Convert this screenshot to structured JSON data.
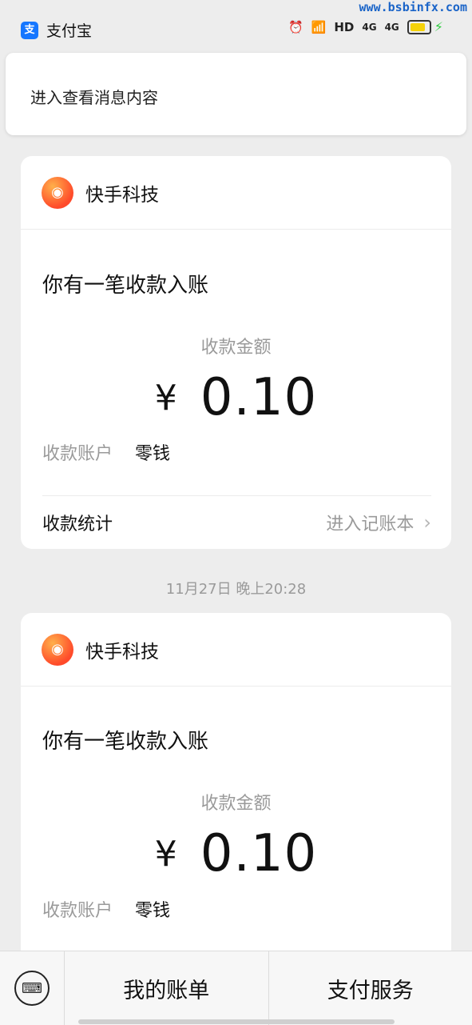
{
  "status_bar": {
    "app_name": "支付宝",
    "app_logo_glyph": "支",
    "alarm_glyph": "⏰",
    "wifi_glyph": "📶",
    "hd_label": "HD",
    "net1": "4G",
    "net2": "4G",
    "watermark": "www.bsbinfx.com"
  },
  "notification": {
    "text": "进入查看消息内容"
  },
  "cards": [
    {
      "merchant": "快手科技",
      "title": "你有一笔收款入账",
      "amount_label": "收款金额",
      "currency": "¥",
      "amount": "0.10",
      "account_key": "收款账户",
      "account_value": "零钱",
      "stats_key": "收款统计",
      "stats_link": "进入记账本"
    },
    {
      "merchant": "快手科技",
      "title": "你有一笔收款入账",
      "amount_label": "收款金额",
      "currency": "¥",
      "amount": "0.10",
      "account_key": "收款账户",
      "account_value": "零钱"
    }
  ],
  "timestamp_2": "11月27日 晚上20:28",
  "bottom_menu": {
    "item1": "我的账单",
    "item2": "支付服务"
  },
  "colors": {
    "brand": "#1677ff",
    "background": "#ededed"
  }
}
